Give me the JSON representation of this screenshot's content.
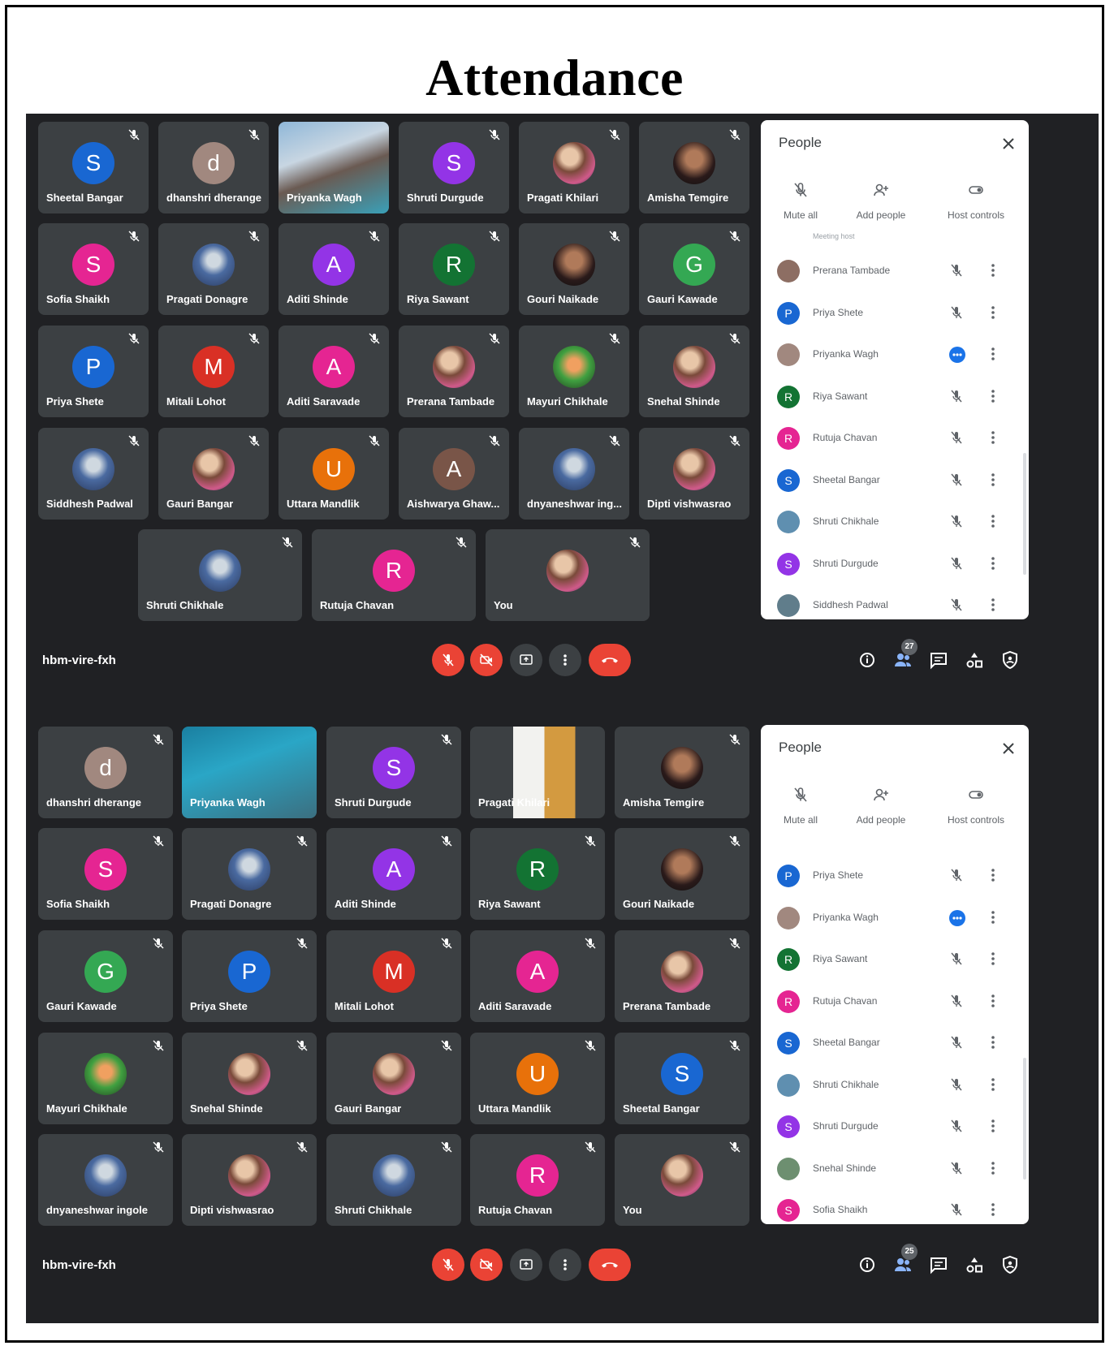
{
  "title": "Attendance",
  "colors": {
    "bg": "#202124",
    "tile": "#3c4043",
    "red": "#ea4335",
    "blue": "#1a73e8"
  },
  "screenshots": [
    {
      "tiles": [
        {
          "name": "Sheetal Bangar",
          "letter": "S",
          "color": "#1967d2"
        },
        {
          "name": "dhanshri dherange",
          "letter": "d",
          "color": "#a1887f"
        },
        {
          "name": "Priyanka Wagh",
          "letter": "",
          "video": true
        },
        {
          "name": "Shruti Durgude",
          "letter": "S",
          "color": "#9334e6"
        },
        {
          "name": "Pragati Khilari",
          "letter": "",
          "photo": "photo"
        },
        {
          "name": "Amisha Temgire",
          "letter": "",
          "photo": "photo3"
        },
        {
          "name": "Sofia Shaikh",
          "letter": "S",
          "color": "#e52592"
        },
        {
          "name": "Pragati Donagre",
          "letter": "",
          "photo": "photo2"
        },
        {
          "name": "Aditi Shinde",
          "letter": "A",
          "color": "#9334e6"
        },
        {
          "name": "Riya Sawant",
          "letter": "R",
          "color": "#137333"
        },
        {
          "name": "Gouri Naikade",
          "letter": "",
          "photo": "photo3"
        },
        {
          "name": "Gauri Kawade",
          "letter": "G",
          "color": "#34a853"
        },
        {
          "name": "Priya Shete",
          "letter": "P",
          "color": "#1967d2"
        },
        {
          "name": "Mitali Lohot",
          "letter": "M",
          "color": "#d93025"
        },
        {
          "name": "Aditi Saravade",
          "letter": "A",
          "color": "#e52592"
        },
        {
          "name": "Prerana Tambade",
          "letter": "",
          "photo": "photo"
        },
        {
          "name": "Mayuri Chikhale",
          "letter": "",
          "photo": "photo4"
        },
        {
          "name": "Snehal Shinde",
          "letter": "",
          "photo": "photo"
        },
        {
          "name": "Siddhesh Padwal",
          "letter": "",
          "photo": "photo2"
        },
        {
          "name": "Gauri Bangar",
          "letter": "",
          "photo": "photo"
        },
        {
          "name": "Uttara Mandlik",
          "letter": "U",
          "color": "#e8710a"
        },
        {
          "name": "Aishwarya Ghaw...",
          "letter": "A",
          "color": "#795548"
        },
        {
          "name": "dnyaneshwar ing...",
          "letter": "",
          "photo": "photo2"
        },
        {
          "name": "Dipti vishwasrao",
          "letter": "",
          "photo": "photo"
        },
        {
          "name": "Shruti Chikhale",
          "letter": "",
          "photo": "photo2"
        },
        {
          "name": "Rutuja Chavan",
          "letter": "R",
          "color": "#e52592"
        },
        {
          "name": "You",
          "letter": "",
          "photo": "photo"
        }
      ],
      "meeting_code": "hbm-vire-fxh",
      "people_count": "27",
      "panel": {
        "title": "People",
        "mute_all": "Mute all",
        "add_people": "Add people",
        "host_controls": "Host controls",
        "partial_label": "Meeting host",
        "rows": [
          {
            "name": "Prerana Tambade",
            "letter": "",
            "color": "#8d6e63",
            "more": false
          },
          {
            "name": "Priya Shete",
            "letter": "P",
            "color": "#1967d2",
            "more": false
          },
          {
            "name": "Priyanka Wagh",
            "letter": "",
            "color": "#a1887f",
            "more": true
          },
          {
            "name": "Riya Sawant",
            "letter": "R",
            "color": "#137333",
            "more": false
          },
          {
            "name": "Rutuja Chavan",
            "letter": "R",
            "color": "#e52592",
            "more": false
          },
          {
            "name": "Sheetal Bangar",
            "letter": "S",
            "color": "#1967d2",
            "more": false
          },
          {
            "name": "Shruti Chikhale",
            "letter": "",
            "color": "#5f8fb0",
            "more": false
          },
          {
            "name": "Shruti Durgude",
            "letter": "S",
            "color": "#9334e6",
            "more": false
          },
          {
            "name": "Siddhesh Padwal",
            "letter": "",
            "color": "#607d8b",
            "more": false
          }
        ]
      }
    },
    {
      "tiles": [
        {
          "name": "dhanshri dherange",
          "letter": "d",
          "color": "#a1887f"
        },
        {
          "name": "Priyanka Wagh",
          "letter": "",
          "video": true
        },
        {
          "name": "Shruti Durgude",
          "letter": "S",
          "color": "#9334e6"
        },
        {
          "name": "Pragati Khilari",
          "letter": "",
          "video": true
        },
        {
          "name": "Amisha Temgire",
          "letter": "",
          "photo": "photo3"
        },
        {
          "name": "Sofia Shaikh",
          "letter": "S",
          "color": "#e52592"
        },
        {
          "name": "Pragati Donagre",
          "letter": "",
          "photo": "photo2"
        },
        {
          "name": "Aditi Shinde",
          "letter": "A",
          "color": "#9334e6"
        },
        {
          "name": "Riya Sawant",
          "letter": "R",
          "color": "#137333"
        },
        {
          "name": "Gouri Naikade",
          "letter": "",
          "photo": "photo3"
        },
        {
          "name": "Gauri Kawade",
          "letter": "G",
          "color": "#34a853"
        },
        {
          "name": "Priya Shete",
          "letter": "P",
          "color": "#1967d2"
        },
        {
          "name": "Mitali Lohot",
          "letter": "M",
          "color": "#d93025"
        },
        {
          "name": "Aditi Saravade",
          "letter": "A",
          "color": "#e52592"
        },
        {
          "name": "Prerana Tambade",
          "letter": "",
          "photo": "photo"
        },
        {
          "name": "Mayuri Chikhale",
          "letter": "",
          "photo": "photo4"
        },
        {
          "name": "Snehal Shinde",
          "letter": "",
          "photo": "photo"
        },
        {
          "name": "Gauri Bangar",
          "letter": "",
          "photo": "photo"
        },
        {
          "name": "Uttara Mandlik",
          "letter": "U",
          "color": "#e8710a"
        },
        {
          "name": "Sheetal Bangar",
          "letter": "S",
          "color": "#1967d2"
        },
        {
          "name": "dnyaneshwar ingole",
          "letter": "",
          "photo": "photo2"
        },
        {
          "name": "Dipti vishwasrao",
          "letter": "",
          "photo": "photo"
        },
        {
          "name": "Shruti Chikhale",
          "letter": "",
          "photo": "photo2"
        },
        {
          "name": "Rutuja Chavan",
          "letter": "R",
          "color": "#e52592"
        },
        {
          "name": "You",
          "letter": "",
          "photo": "photo"
        }
      ],
      "meeting_code": "hbm-vire-fxh",
      "people_count": "25",
      "panel": {
        "title": "People",
        "mute_all": "Mute all",
        "add_people": "Add people",
        "host_controls": "Host controls",
        "partial_label": "",
        "rows": [
          {
            "name": "Priya Shete",
            "letter": "P",
            "color": "#1967d2",
            "more": false
          },
          {
            "name": "Priyanka Wagh",
            "letter": "",
            "color": "#a1887f",
            "more": true
          },
          {
            "name": "Riya Sawant",
            "letter": "R",
            "color": "#137333",
            "more": false
          },
          {
            "name": "Rutuja Chavan",
            "letter": "R",
            "color": "#e52592",
            "more": false
          },
          {
            "name": "Sheetal Bangar",
            "letter": "S",
            "color": "#1967d2",
            "more": false
          },
          {
            "name": "Shruti Chikhale",
            "letter": "",
            "color": "#5f8fb0",
            "more": false
          },
          {
            "name": "Shruti Durgude",
            "letter": "S",
            "color": "#9334e6",
            "more": false
          },
          {
            "name": "Snehal Shinde",
            "letter": "",
            "color": "#6d8f70",
            "more": false
          },
          {
            "name": "Sofia Shaikh",
            "letter": "S",
            "color": "#e52592",
            "more": false
          }
        ]
      }
    }
  ]
}
